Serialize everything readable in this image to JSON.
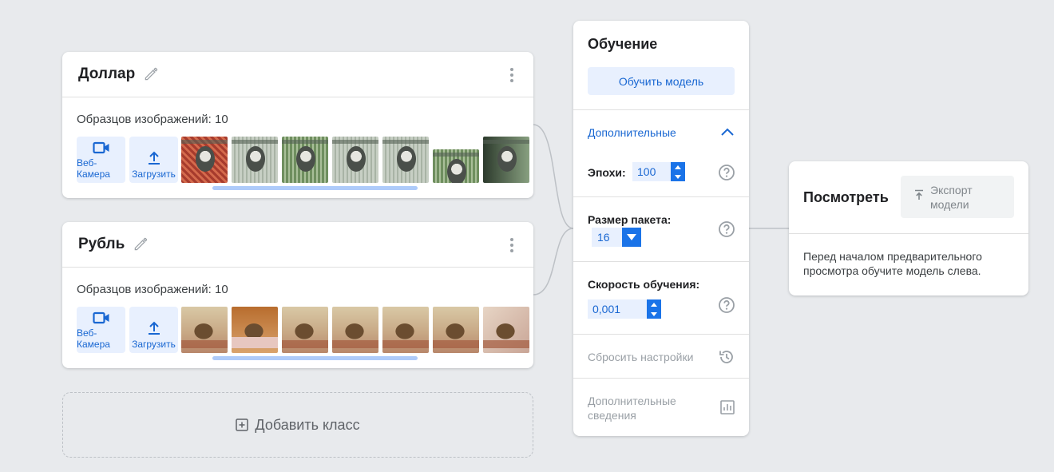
{
  "classes": [
    {
      "name": "Доллар",
      "samples_label": "Образцов изображений: 10",
      "webcam_label": "Веб-Камера",
      "upload_label": "Загрузить"
    },
    {
      "name": "Рубль",
      "samples_label": "Образцов изображений: 10",
      "webcam_label": "Веб-Камера",
      "upload_label": "Загрузить"
    }
  ],
  "add_class_label": "Добавить класс",
  "training": {
    "title": "Обучение",
    "train_button": "Обучить модель",
    "advanced_label": "Дополнительные",
    "epochs_label": "Эпохи:",
    "epochs_value": "100",
    "batch_label": "Размер пакета:",
    "batch_value": "16",
    "lr_label": "Скорость обучения:",
    "lr_value": "0,001",
    "reset_label": "Сбросить настройки",
    "details_label_line1": "Дополнительные",
    "details_label_line2": "сведения"
  },
  "preview": {
    "title": "Посмотреть",
    "export_line1": "Экспорт",
    "export_line2": "модели",
    "message": "Перед началом предварительного просмотра обучите модель слева."
  },
  "colors": {
    "accent": "#1967d2",
    "accent_light": "#e8f0fe",
    "background": "#e8eaed"
  }
}
